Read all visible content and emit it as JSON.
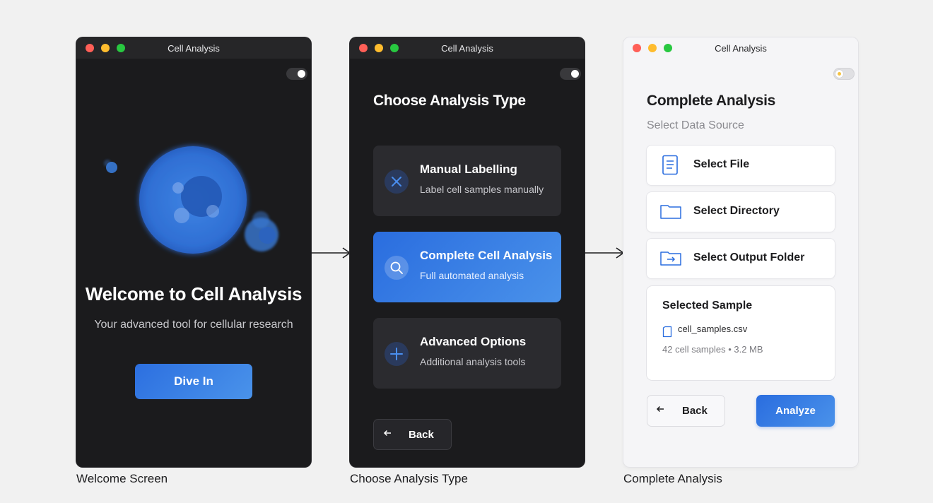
{
  "colors": {
    "background": "#f1f1f1",
    "dark_window": "#1b1b1d",
    "accent_blue": "#2c6fe0",
    "accent_blue_light": "#4a93ea"
  },
  "screens": [
    {
      "window_title": "Cell Analysis",
      "caption": "Welcome Screen",
      "theme": "dark",
      "title": "Welcome to Cell Analysis",
      "subtitle": "Your advanced tool for cellular research",
      "primary_button": "Dive In"
    },
    {
      "window_title": "Cell Analysis",
      "caption": "Choose Analysis Type",
      "theme": "dark",
      "heading": "Choose Analysis Type",
      "options": [
        {
          "title": "Manual Labelling",
          "subtitle": "Label cell samples manually",
          "icon": "close-x-icon",
          "selected": false
        },
        {
          "title": "Complete Cell Analysis",
          "subtitle": "Full automated analysis",
          "icon": "search-icon",
          "selected": true
        },
        {
          "title": "Advanced Options",
          "subtitle": "Additional analysis tools",
          "icon": "plus-icon",
          "selected": false
        }
      ],
      "back_label": "Back",
      "back_icon": "arrow-left-icon"
    },
    {
      "window_title": "Cell Analysis",
      "caption": "Complete Analysis",
      "theme": "light",
      "heading": "Complete Analysis",
      "subheading": "Select Data Source",
      "sources": [
        {
          "label": "Select File",
          "icon": "document-icon"
        },
        {
          "label": "Select Directory",
          "icon": "folder-icon"
        },
        {
          "label": "Select Output Folder",
          "icon": "folder-output-icon"
        }
      ],
      "sample": {
        "title": "Selected Sample",
        "file_name": "cell_samples.csv",
        "meta": "42 cell samples • 3.2 MB",
        "file_icon": "file-icon"
      },
      "back_label": "Back",
      "back_icon": "arrow-left-icon",
      "primary_button": "Analyze"
    }
  ],
  "flow_arrows": [
    "arrow-right-icon",
    "arrow-right-icon"
  ]
}
